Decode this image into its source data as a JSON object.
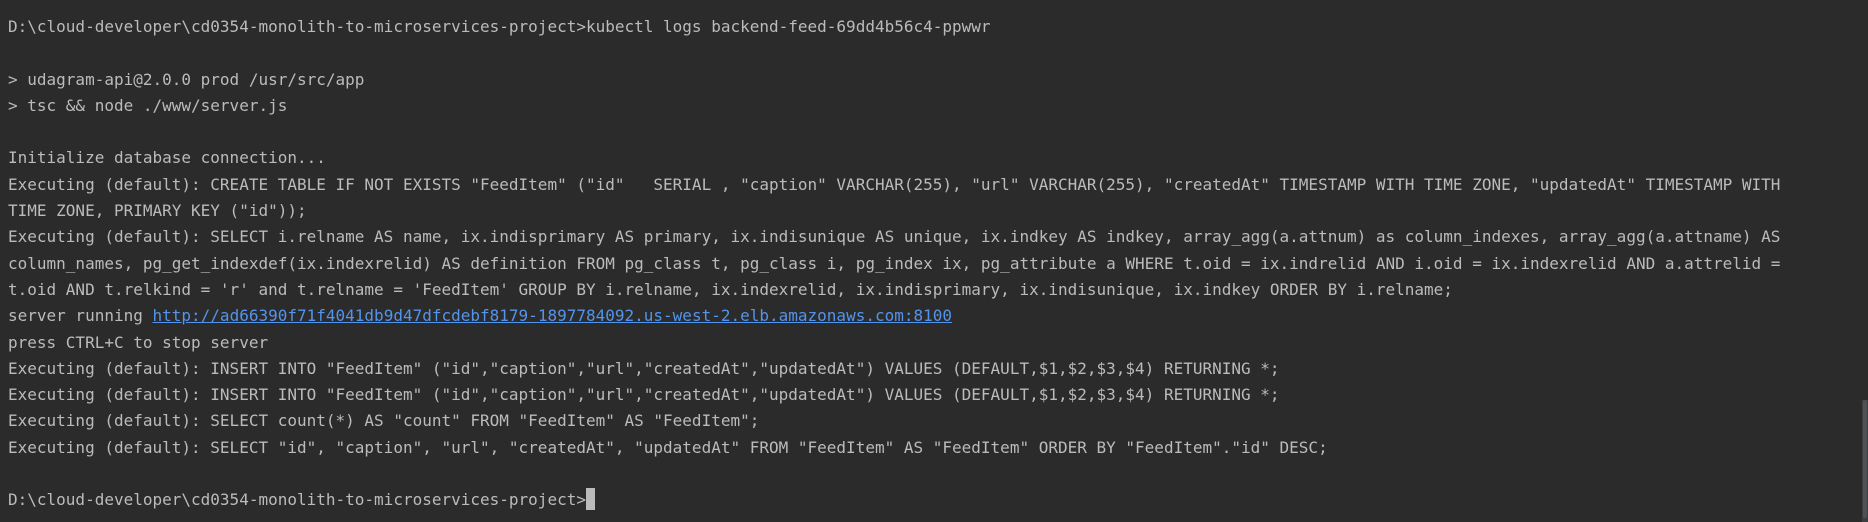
{
  "terminal": {
    "command_line": "D:\\cloud-developer\\cd0354-monolith-to-microservices-project>kubectl logs backend-feed-69dd4b56c4-ppwwr",
    "npm_line1": "> udagram-api@2.0.0 prod /usr/src/app",
    "npm_line2": "> tsc && node ./www/server.js",
    "init_db": "Initialize database connection...",
    "create_table_1": "Executing (default): CREATE TABLE IF NOT EXISTS \"FeedItem\" (\"id\"   SERIAL , \"caption\" VARCHAR(255), \"url\" VARCHAR(255), \"createdAt\" TIMESTAMP WITH TIME ZONE, \"updatedAt\" TIMESTAMP WITH",
    "create_table_2": "TIME ZONE, PRIMARY KEY (\"id\"));",
    "select_index_1": "Executing (default): SELECT i.relname AS name, ix.indisprimary AS primary, ix.indisunique AS unique, ix.indkey AS indkey, array_agg(a.attnum) as column_indexes, array_agg(a.attname) AS",
    "select_index_2": "column_names, pg_get_indexdef(ix.indexrelid) AS definition FROM pg_class t, pg_class i, pg_index ix, pg_attribute a WHERE t.oid = ix.indrelid AND i.oid = ix.indexrelid AND a.attrelid =",
    "select_index_3": "t.oid AND t.relkind = 'r' and t.relname = 'FeedItem' GROUP BY i.relname, ix.indexrelid, ix.indisprimary, ix.indisunique, ix.indkey ORDER BY i.relname;",
    "server_running_prefix": "server running ",
    "server_url": "http://ad66390f71f4041db9d47dfcdebf8179-1897784092.us-west-2.elb.amazonaws.com:8100",
    "press_ctrl_c": "press CTRL+C to stop server",
    "insert_1": "Executing (default): INSERT INTO \"FeedItem\" (\"id\",\"caption\",\"url\",\"createdAt\",\"updatedAt\") VALUES (DEFAULT,$1,$2,$3,$4) RETURNING *;",
    "insert_2": "Executing (default): INSERT INTO \"FeedItem\" (\"id\",\"caption\",\"url\",\"createdAt\",\"updatedAt\") VALUES (DEFAULT,$1,$2,$3,$4) RETURNING *;",
    "select_count": "Executing (default): SELECT count(*) AS \"count\" FROM \"FeedItem\" AS \"FeedItem\";",
    "select_all": "Executing (default): SELECT \"id\", \"caption\", \"url\", \"createdAt\", \"updatedAt\" FROM \"FeedItem\" AS \"FeedItem\" ORDER BY \"FeedItem\".\"id\" DESC;",
    "prompt": "D:\\cloud-developer\\cd0354-monolith-to-microservices-project>"
  },
  "colors": {
    "background": "#2b2b2b",
    "text": "#bbbbbb",
    "link": "#5394ec"
  }
}
